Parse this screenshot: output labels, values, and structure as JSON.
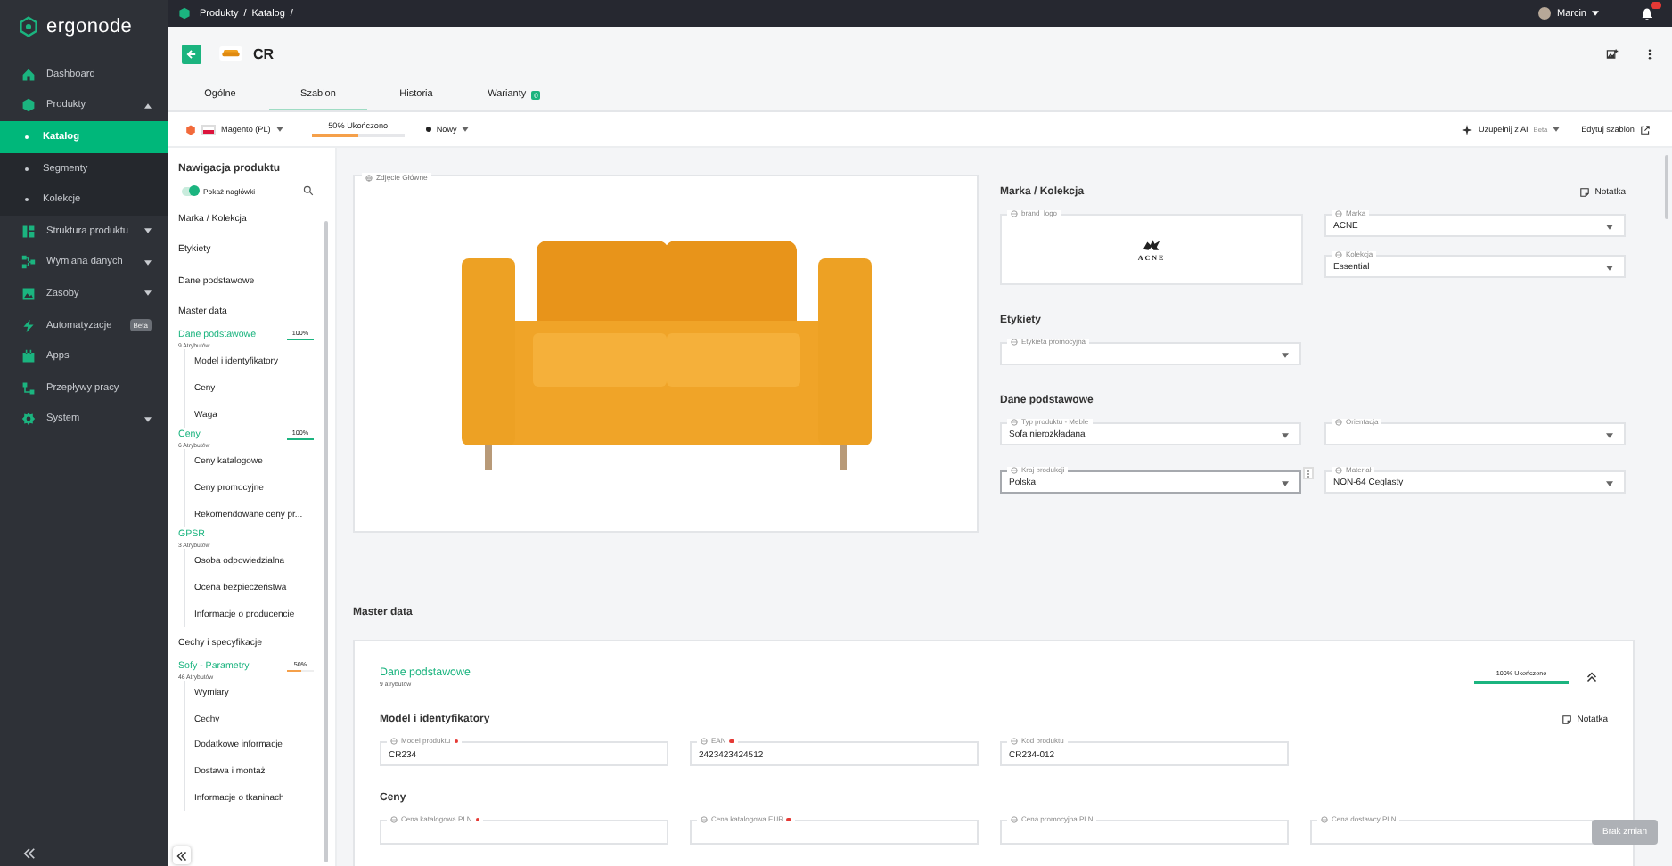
{
  "sidebar": {
    "logo": "ergonode",
    "items": [
      {
        "label": "Dashboard"
      },
      {
        "label": "Produkty",
        "expanded": true,
        "children": [
          {
            "label": "Katalog",
            "selected": true
          },
          {
            "label": "Segmenty",
            "selected": false
          },
          {
            "label": "Kolekcje",
            "selected": false
          }
        ]
      },
      {
        "label": "Struktura produktu",
        "expanded": false
      },
      {
        "label": "Wymiana danych",
        "expanded": false
      },
      {
        "label": "Zasoby",
        "expanded": false
      },
      {
        "label": "Automatyzacje",
        "badge": "Beta"
      },
      {
        "label": "Apps"
      },
      {
        "label": "Przepływy pracy"
      },
      {
        "label": "System",
        "expanded": false
      }
    ]
  },
  "topbar": {
    "breadcrumbs": [
      "Produkty",
      "Katalog"
    ],
    "separator": "/",
    "user": "Marcin"
  },
  "header": {
    "title": "CR",
    "tabs": [
      {
        "label": "Ogólne",
        "selected": false
      },
      {
        "label": "Szablon",
        "selected": true
      },
      {
        "label": "Historia",
        "selected": false
      },
      {
        "label": "Warianty",
        "selected": false,
        "badge": "0"
      }
    ]
  },
  "toolbar": {
    "channel": "Magento (PL)",
    "completion": {
      "label": "50% Ukończono",
      "level": 0.5
    },
    "status": "Nowy",
    "ai": {
      "label": "Uzupełnij z AI",
      "badge": "Beta"
    },
    "edit_template": "Edytuj szablon"
  },
  "nav": {
    "title": "Nawigacja produktu",
    "show_headers": {
      "label": "Pokaż nagłówki",
      "on": true
    },
    "items": [
      {
        "kind": "section",
        "label": "Marka / Kolekcja"
      },
      {
        "kind": "section",
        "label": "Etykiety"
      },
      {
        "kind": "section",
        "label": "Dane podstawowe"
      },
      {
        "kind": "section",
        "label": "Master data"
      },
      {
        "kind": "group",
        "label": "Dane podstawowe",
        "count": "9 Atrybutów",
        "percent": "100%",
        "level": 1,
        "children": [
          "Model i identyfikatory",
          "Ceny",
          "Waga"
        ]
      },
      {
        "kind": "group",
        "label": "Ceny",
        "count": "6 Atrybutów",
        "percent": "100%",
        "level": 1,
        "children": [
          "Ceny katalogowe",
          "Ceny promocyjne",
          "Rekomendowane ceny pr..."
        ]
      },
      {
        "kind": "group",
        "label": "GPSR",
        "count": "3 Atrybutów",
        "children": [
          "Osoba odpowiedzialna",
          "Ocena bezpieczeństwa",
          "Informacje o producencie"
        ]
      },
      {
        "kind": "section",
        "label": "Cechy i specyfikacje"
      },
      {
        "kind": "group",
        "label": "Sofy - Parametry",
        "count": "46 Atrybutów",
        "percent": "50%",
        "level": 0.5,
        "children": [
          "Wymiary",
          "Cechy",
          "Dodatkowe informacje",
          "Dostawa i montaż",
          "Informacje o tkaninach"
        ]
      }
    ]
  },
  "main_image": {
    "label": "Zdjęcie Główne"
  },
  "brand": {
    "title": "Marka / Kolekcja",
    "note": "Notatka",
    "logo": {
      "label": "brand_logo",
      "text": "ACNE"
    },
    "fields": [
      {
        "label": "Marka",
        "value": "ACNE"
      },
      {
        "label": "Kolekcja",
        "value": "Essential"
      }
    ]
  },
  "right_sections": [
    {
      "title": "Etykiety",
      "fields": [
        {
          "label": "Etykieta promocyjna",
          "focused": false
        }
      ]
    },
    {
      "title": "Dane podstawowe",
      "fields": [
        {
          "label": "Typ produktu - Meble",
          "value": "Sofa nierozkładana",
          "focused": false
        },
        {
          "label": "Orientacja",
          "focused": false
        },
        {
          "label": "Kraj produkcji",
          "value": "Polska",
          "focused": true
        },
        {
          "label": "Materiał",
          "value": "NON-64 Ceglasty",
          "focused": false
        }
      ]
    }
  ],
  "master": {
    "title": "Master data",
    "group": {
      "title": "Dane podstawowe",
      "count": "9 atrybutów",
      "progress": {
        "label": "100% Ukończono",
        "level": 1
      },
      "expanded": true
    },
    "sections": [
      {
        "title": "Model i identyfikatory",
        "note": "Notatka",
        "fields": [
          {
            "label": "Model produktu",
            "required": true,
            "value": "CR234"
          },
          {
            "label": "EAN",
            "required": true,
            "value": "2423423424512"
          },
          {
            "label": "Kod produktu",
            "required": false,
            "value": "CR234-012"
          }
        ]
      },
      {
        "title": "Ceny",
        "fields": [
          {
            "label": "Cena katalogowa PLN",
            "required": true
          },
          {
            "label": "Cena katalogowa EUR",
            "required": true
          },
          {
            "label": "Cena promocyjna PLN",
            "required": false
          },
          {
            "label": "Cena dostawcy PLN",
            "required": false
          }
        ]
      }
    ]
  },
  "save_button": {
    "label": "Brak zmian",
    "disabled": true
  }
}
